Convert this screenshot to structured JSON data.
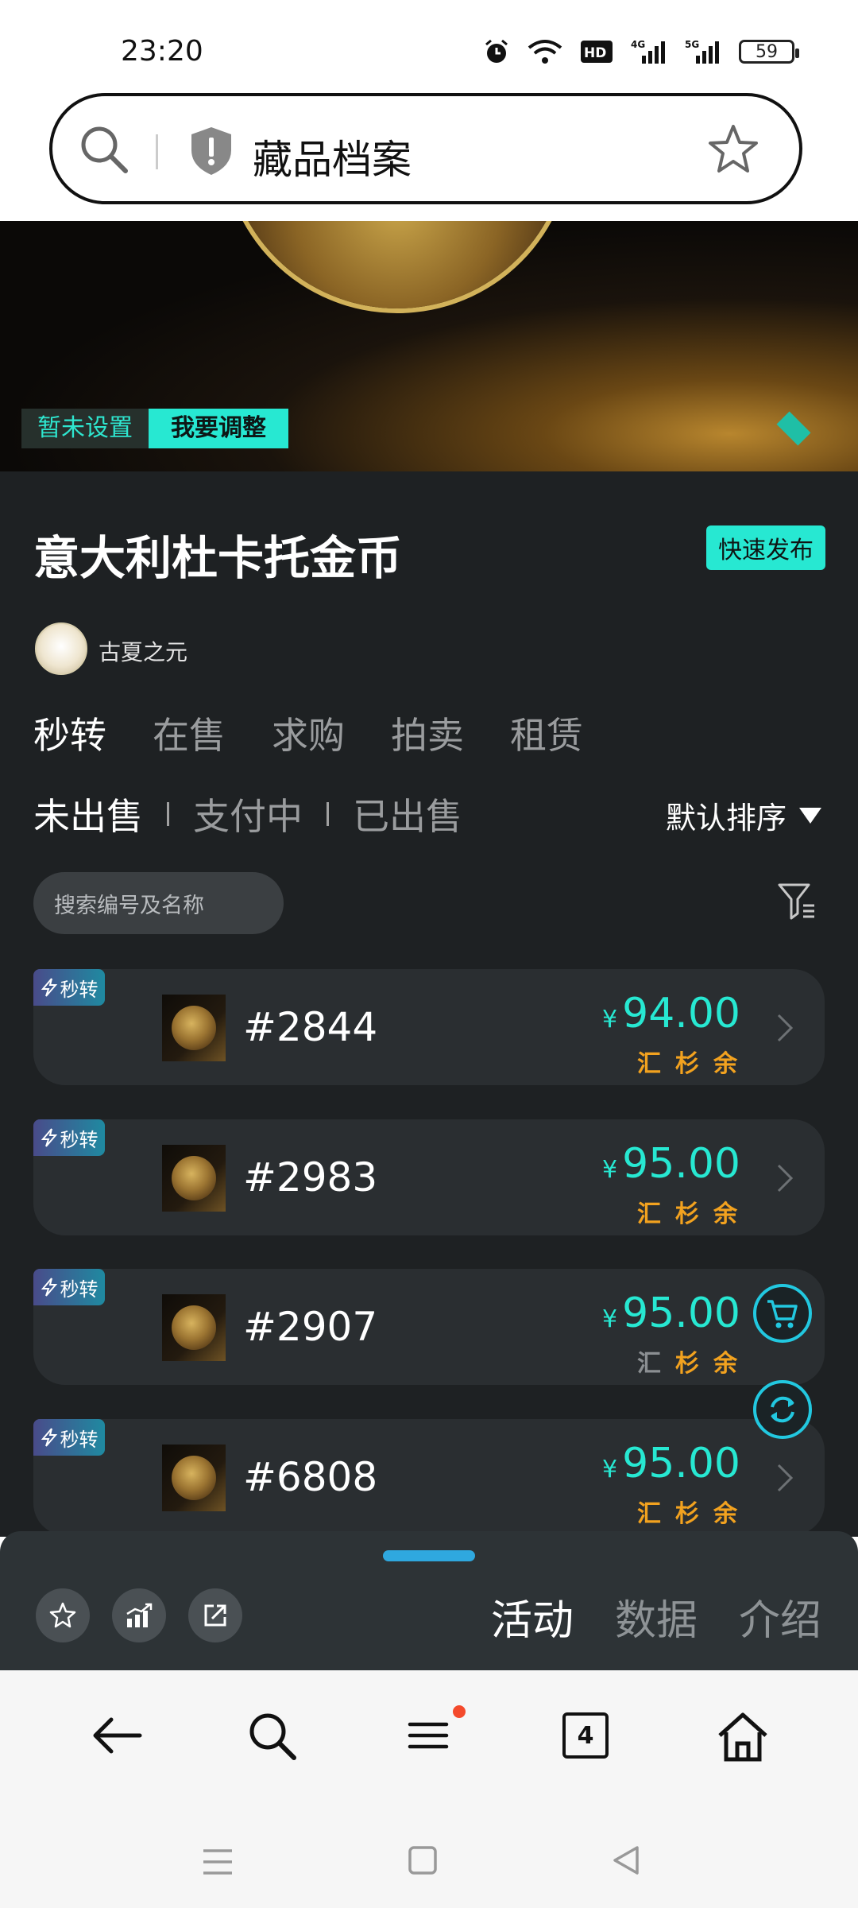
{
  "status_bar": {
    "time": "23:20",
    "battery": "59"
  },
  "address_bar": {
    "title": "藏品档案"
  },
  "hero": {
    "tag_unset": "暂未设置",
    "tag_adjust": "我要调整"
  },
  "collection": {
    "title": "意大利杜卡托金币",
    "quick_publish": "快速发布",
    "owner": "古夏之元"
  },
  "tabs": [
    "秒转",
    "在售",
    "求购",
    "拍卖",
    "租赁"
  ],
  "subtabs": [
    "未出售",
    "支付中",
    "已出售"
  ],
  "sort": "默认排序",
  "search_placeholder": "搜索编号及名称",
  "items": [
    {
      "badge": "秒转",
      "code": "#2844",
      "currency": "¥",
      "price": "94.00",
      "labels": [
        "汇",
        "杉",
        "余"
      ]
    },
    {
      "badge": "秒转",
      "code": "#2983",
      "currency": "¥",
      "price": "95.00",
      "labels": [
        "汇",
        "杉",
        "余"
      ]
    },
    {
      "badge": "秒转",
      "code": "#2907",
      "currency": "¥",
      "price": "95.00",
      "labels": [
        "汇",
        "杉",
        "余"
      ]
    },
    {
      "badge": "秒转",
      "code": "#6808",
      "currency": "¥",
      "price": "95.00",
      "labels": [
        "汇",
        "杉",
        "余"
      ]
    }
  ],
  "bottom_sheet": {
    "tabs": [
      "活动",
      "数据",
      "介绍"
    ]
  },
  "browser_nav": {
    "tab_count": "4"
  },
  "colors": {
    "accent": "#27e8d2",
    "label_orange": "#f2a21f",
    "dark_bg": "#1e2123"
  }
}
